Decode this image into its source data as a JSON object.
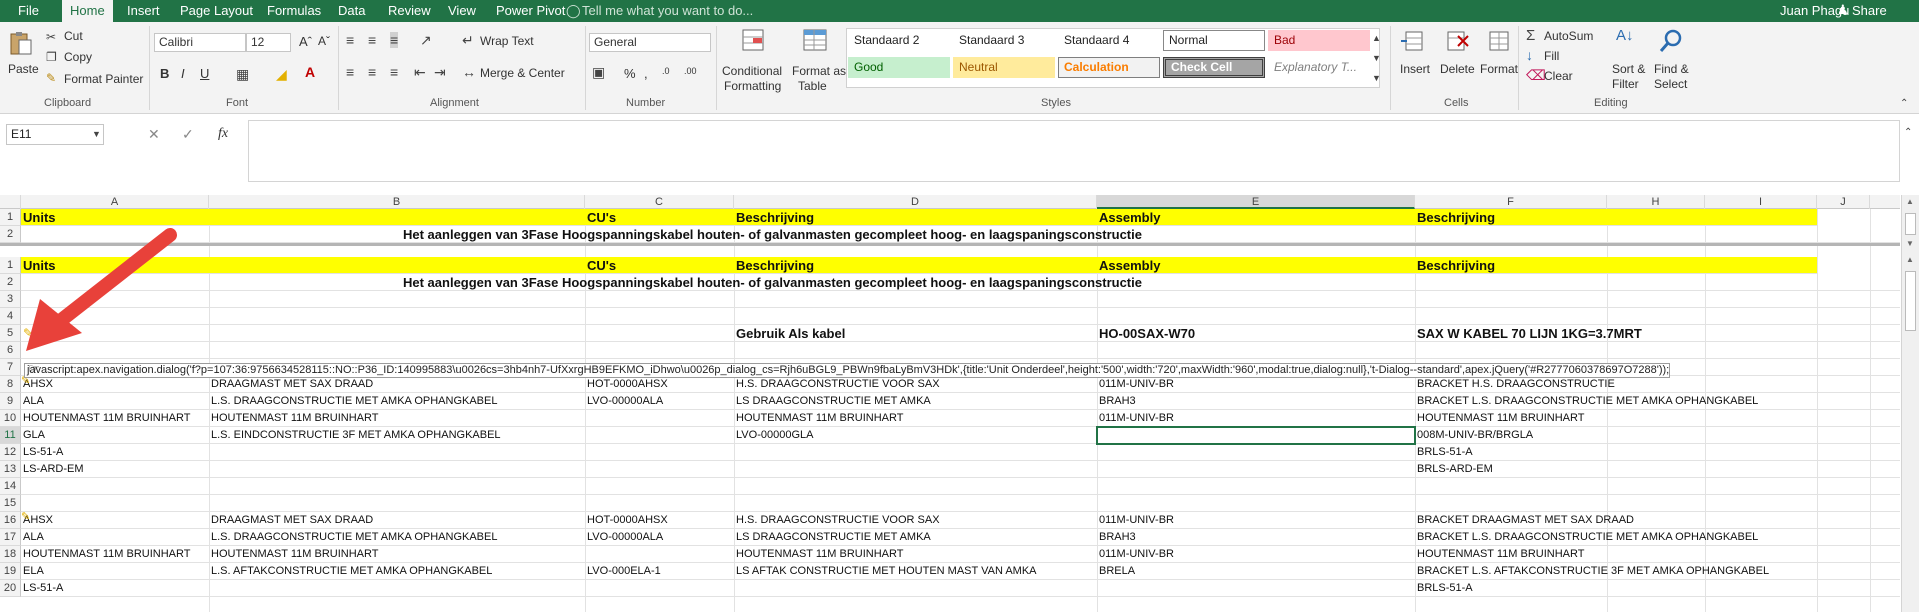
{
  "menu": {
    "file": "File",
    "tabs": [
      "Home",
      "Insert",
      "Page Layout",
      "Formulas",
      "Data",
      "Review",
      "View",
      "Power Pivot"
    ],
    "tell_me": "Tell me what you want to do...",
    "user": "Juan Phagu",
    "share": "Share"
  },
  "ribbon": {
    "clipboard": {
      "paste": "Paste",
      "cut": "Cut",
      "copy": "Copy",
      "format_painter": "Format Painter",
      "group": "Clipboard"
    },
    "font": {
      "name": "Calibri",
      "size": "12",
      "bold": "B",
      "italic": "I",
      "underline": "U",
      "group": "Font"
    },
    "alignment": {
      "wrap": "Wrap Text",
      "merge": "Merge & Center",
      "group": "Alignment"
    },
    "number": {
      "format": "General",
      "group": "Number"
    },
    "styles": {
      "conditional_l1": "Conditional",
      "conditional_l2": "Formatting",
      "format_table_l1": "Format as",
      "format_table_l2": "Table",
      "cells": [
        "Standaard 2",
        "Standaard 3",
        "Standaard 4",
        "Normal",
        "Bad",
        "Good",
        "Neutral",
        "Calculation",
        "Check Cell",
        "Explanatory T..."
      ],
      "group": "Styles"
    },
    "cells": {
      "insert": "Insert",
      "delete": "Delete",
      "format": "Format",
      "group": "Cells"
    },
    "editing": {
      "autosum": "AutoSum",
      "fill": "Fill",
      "clear": "Clear",
      "sort_l1": "Sort &",
      "sort_l2": "Filter",
      "find_l1": "Find &",
      "find_l2": "Select",
      "group": "Editing"
    }
  },
  "formula_bar": {
    "name_box": "E11",
    "fx": "fx",
    "value": ""
  },
  "columns": [
    "A",
    "B",
    "C",
    "D",
    "E",
    "F",
    "H",
    "I",
    "J"
  ],
  "frozen_rows": [
    {
      "row": "1",
      "cells": [
        "Units",
        "",
        "CU's",
        "Beschrijving",
        "Assembly",
        "Beschrijving"
      ]
    },
    {
      "row": "2",
      "title": "Het aanleggen van 3Fase Hoogspanningskabel houten- of galvanmasten gecompleet hoog- en laagspaningsconstructie"
    }
  ],
  "rows": [
    {
      "row": "1",
      "cells": [
        "Units",
        "",
        "CU's",
        "Beschrijving",
        "Assembly",
        "Beschrijving"
      ]
    },
    {
      "row": "2",
      "title": "Het aanleggen van 3Fase Hoogspanningskabel houten- of galvanmasten gecompleet hoog- en laagspaningsconstructie"
    },
    {
      "row": "3",
      "cells": [
        "",
        "",
        "",
        "",
        "",
        ""
      ]
    },
    {
      "row": "4",
      "cells": [
        "",
        "",
        "",
        "",
        "",
        ""
      ]
    },
    {
      "row": "5",
      "cells": [
        "",
        "",
        "",
        "Gebruik Als kabel",
        "HO-00SAX-W70",
        "SAX W KABEL 70 LIJN 1KG=3.7MRT"
      ]
    },
    {
      "row": "6",
      "cells": [
        "",
        "",
        "",
        "",
        "",
        ""
      ]
    },
    {
      "row": "7",
      "cells": [
        "",
        "",
        "",
        "",
        "",
        ""
      ]
    },
    {
      "row": "8",
      "cells": [
        "AHSX",
        "DRAAGMAST MET SAX DRAAD",
        "HOT-0000AHSX",
        "H.S. DRAAGCONSTRUCTIE VOOR SAX",
        "011M-UNIV-BR",
        "BRACKET H.S. DRAAGCONSTRUCTIE"
      ]
    },
    {
      "row": "9",
      "cells": [
        "ALA",
        "L.S. DRAAGCONSTRUCTIE MET AMKA OPHANGKABEL",
        "LVO-00000ALA",
        "LS DRAAGCONSTRUCTIE MET AMKA",
        "BRAH3",
        "BRACKET L.S. DRAAGCONSTRUCTIE MET AMKA OPHANGKABEL"
      ]
    },
    {
      "row": "10",
      "cells": [
        "HOUTENMAST 11M BRUINHART",
        "HOUTENMAST 11M BRUINHART",
        "",
        "HOUTENMAST 11M BRUINHART",
        "011M-UNIV-BR",
        "HOUTENMAST 11M BRUINHART"
      ]
    },
    {
      "row": "11",
      "cells": [
        "GLA",
        "L.S. EINDCONSTRUCTIE 3F MET AMKA OPHANGKABEL",
        "",
        "LVO-00000GLA",
        "",
        "008M-UNIV-BR/BRGLA"
      ]
    },
    {
      "row": "12",
      "cells": [
        "LS-51-A",
        "",
        "",
        "",
        "",
        "BRLS-51-A"
      ]
    },
    {
      "row": "13",
      "cells": [
        "LS-ARD-EM",
        "",
        "",
        "",
        "",
        "BRLS-ARD-EM"
      ]
    },
    {
      "row": "14",
      "cells": [
        "",
        "",
        "",
        "",
        "",
        ""
      ]
    },
    {
      "row": "15",
      "cells": [
        "",
        "",
        "",
        "",
        "",
        ""
      ]
    },
    {
      "row": "16",
      "cells": [
        "AHSX",
        "DRAAGMAST MET SAX DRAAD",
        "HOT-0000AHSX",
        "H.S. DRAAGCONSTRUCTIE VOOR SAX",
        "011M-UNIV-BR",
        "BRACKET DRAAGMAST MET SAX DRAAD"
      ]
    },
    {
      "row": "17",
      "cells": [
        "ALA",
        "L.S. DRAAGCONSTRUCTIE MET AMKA OPHANGKABEL",
        "LVO-00000ALA",
        "LS DRAAGCONSTRUCTIE MET AMKA",
        "BRAH3",
        "BRACKET L.S. DRAAGCONSTRUCTIE MET AMKA OPHANGKABEL"
      ]
    },
    {
      "row": "18",
      "cells": [
        "HOUTENMAST 11M BRUINHART",
        "HOUTENMAST 11M BRUINHART",
        "",
        "HOUTENMAST 11M BRUINHART",
        "011M-UNIV-BR",
        "HOUTENMAST 11M BRUINHART"
      ]
    },
    {
      "row": "19",
      "cells": [
        "ELA",
        "L.S. AFTAKCONSTRUCTIE MET AMKA OPHANGKABEL",
        "LVO-000ELA-1",
        "LS AFTAK CONSTRUCTIE MET HOUTEN MAST VAN AMKA",
        "BRELA",
        "BRACKET L.S. AFTAKCONSTRUCTIE 3F MET AMKA OPHANGKABEL"
      ]
    },
    {
      "row": "20",
      "cells": [
        "LS-51-A",
        "",
        "",
        "",
        "",
        "BRLS-51-A"
      ]
    }
  ],
  "tooltip": "javascript:apex.navigation.dialog('f?p=107:36:9756634528115::NO::P36_ID:140995883\\u0026cs=3hb4nh7-UfXxrgHB9EFKMO_iDhwo\\u0026p_dialog_cs=Rjh6uBGL9_PBWn9fbaLyBmV3HDk',{title:'Unit Onderdeel',height:'500',width:'720',maxWidth:'960',modal:true,dialog:null},'t-Dialog--standard',apex.jQuery('#R2777060378697O7288'));",
  "colors": {
    "excel_green": "#217346",
    "header_yellow": "#ffff00",
    "arrow_red": "#e8413a"
  }
}
